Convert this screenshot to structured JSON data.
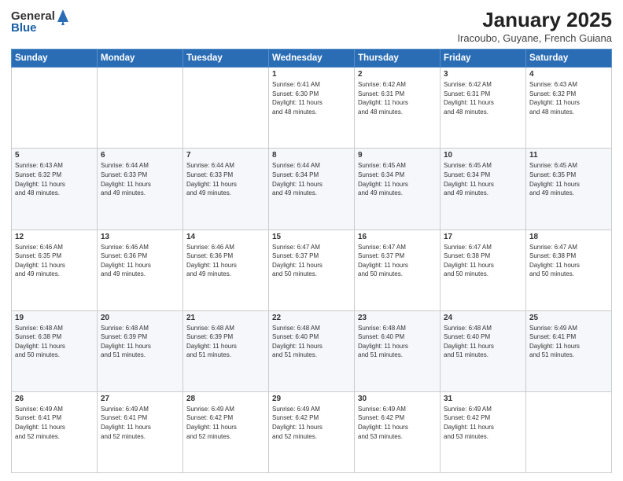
{
  "logo": {
    "general": "General",
    "blue": "Blue"
  },
  "title": "January 2025",
  "subtitle": "Iracoubo, Guyane, French Guiana",
  "days_of_week": [
    "Sunday",
    "Monday",
    "Tuesday",
    "Wednesday",
    "Thursday",
    "Friday",
    "Saturday"
  ],
  "weeks": [
    [
      {
        "day": "",
        "info": ""
      },
      {
        "day": "",
        "info": ""
      },
      {
        "day": "",
        "info": ""
      },
      {
        "day": "1",
        "info": "Sunrise: 6:41 AM\nSunset: 6:30 PM\nDaylight: 11 hours\nand 48 minutes."
      },
      {
        "day": "2",
        "info": "Sunrise: 6:42 AM\nSunset: 6:31 PM\nDaylight: 11 hours\nand 48 minutes."
      },
      {
        "day": "3",
        "info": "Sunrise: 6:42 AM\nSunset: 6:31 PM\nDaylight: 11 hours\nand 48 minutes."
      },
      {
        "day": "4",
        "info": "Sunrise: 6:43 AM\nSunset: 6:32 PM\nDaylight: 11 hours\nand 48 minutes."
      }
    ],
    [
      {
        "day": "5",
        "info": "Sunrise: 6:43 AM\nSunset: 6:32 PM\nDaylight: 11 hours\nand 48 minutes."
      },
      {
        "day": "6",
        "info": "Sunrise: 6:44 AM\nSunset: 6:33 PM\nDaylight: 11 hours\nand 49 minutes."
      },
      {
        "day": "7",
        "info": "Sunrise: 6:44 AM\nSunset: 6:33 PM\nDaylight: 11 hours\nand 49 minutes."
      },
      {
        "day": "8",
        "info": "Sunrise: 6:44 AM\nSunset: 6:34 PM\nDaylight: 11 hours\nand 49 minutes."
      },
      {
        "day": "9",
        "info": "Sunrise: 6:45 AM\nSunset: 6:34 PM\nDaylight: 11 hours\nand 49 minutes."
      },
      {
        "day": "10",
        "info": "Sunrise: 6:45 AM\nSunset: 6:34 PM\nDaylight: 11 hours\nand 49 minutes."
      },
      {
        "day": "11",
        "info": "Sunrise: 6:45 AM\nSunset: 6:35 PM\nDaylight: 11 hours\nand 49 minutes."
      }
    ],
    [
      {
        "day": "12",
        "info": "Sunrise: 6:46 AM\nSunset: 6:35 PM\nDaylight: 11 hours\nand 49 minutes."
      },
      {
        "day": "13",
        "info": "Sunrise: 6:46 AM\nSunset: 6:36 PM\nDaylight: 11 hours\nand 49 minutes."
      },
      {
        "day": "14",
        "info": "Sunrise: 6:46 AM\nSunset: 6:36 PM\nDaylight: 11 hours\nand 49 minutes."
      },
      {
        "day": "15",
        "info": "Sunrise: 6:47 AM\nSunset: 6:37 PM\nDaylight: 11 hours\nand 50 minutes."
      },
      {
        "day": "16",
        "info": "Sunrise: 6:47 AM\nSunset: 6:37 PM\nDaylight: 11 hours\nand 50 minutes."
      },
      {
        "day": "17",
        "info": "Sunrise: 6:47 AM\nSunset: 6:38 PM\nDaylight: 11 hours\nand 50 minutes."
      },
      {
        "day": "18",
        "info": "Sunrise: 6:47 AM\nSunset: 6:38 PM\nDaylight: 11 hours\nand 50 minutes."
      }
    ],
    [
      {
        "day": "19",
        "info": "Sunrise: 6:48 AM\nSunset: 6:38 PM\nDaylight: 11 hours\nand 50 minutes."
      },
      {
        "day": "20",
        "info": "Sunrise: 6:48 AM\nSunset: 6:39 PM\nDaylight: 11 hours\nand 51 minutes."
      },
      {
        "day": "21",
        "info": "Sunrise: 6:48 AM\nSunset: 6:39 PM\nDaylight: 11 hours\nand 51 minutes."
      },
      {
        "day": "22",
        "info": "Sunrise: 6:48 AM\nSunset: 6:40 PM\nDaylight: 11 hours\nand 51 minutes."
      },
      {
        "day": "23",
        "info": "Sunrise: 6:48 AM\nSunset: 6:40 PM\nDaylight: 11 hours\nand 51 minutes."
      },
      {
        "day": "24",
        "info": "Sunrise: 6:48 AM\nSunset: 6:40 PM\nDaylight: 11 hours\nand 51 minutes."
      },
      {
        "day": "25",
        "info": "Sunrise: 6:49 AM\nSunset: 6:41 PM\nDaylight: 11 hours\nand 51 minutes."
      }
    ],
    [
      {
        "day": "26",
        "info": "Sunrise: 6:49 AM\nSunset: 6:41 PM\nDaylight: 11 hours\nand 52 minutes."
      },
      {
        "day": "27",
        "info": "Sunrise: 6:49 AM\nSunset: 6:41 PM\nDaylight: 11 hours\nand 52 minutes."
      },
      {
        "day": "28",
        "info": "Sunrise: 6:49 AM\nSunset: 6:42 PM\nDaylight: 11 hours\nand 52 minutes."
      },
      {
        "day": "29",
        "info": "Sunrise: 6:49 AM\nSunset: 6:42 PM\nDaylight: 11 hours\nand 52 minutes."
      },
      {
        "day": "30",
        "info": "Sunrise: 6:49 AM\nSunset: 6:42 PM\nDaylight: 11 hours\nand 53 minutes."
      },
      {
        "day": "31",
        "info": "Sunrise: 6:49 AM\nSunset: 6:42 PM\nDaylight: 11 hours\nand 53 minutes."
      },
      {
        "day": "",
        "info": ""
      }
    ]
  ]
}
